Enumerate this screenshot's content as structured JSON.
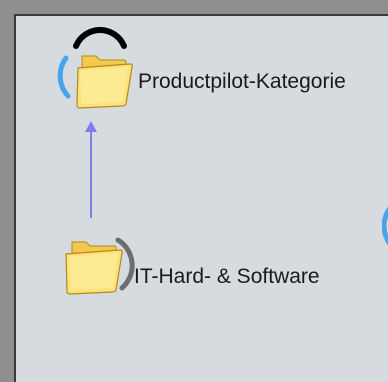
{
  "graph": {
    "nodes": [
      {
        "label": "Productpilot-Kategorie",
        "icon": "folder-icon",
        "expander": "expand-ring"
      },
      {
        "label": "IT-Hard- & Software",
        "icon": "folder-icon",
        "expander": "expand-ring"
      }
    ]
  },
  "colors": {
    "canvas": "#d6dbdf",
    "frame": "#8f8f8f",
    "edge": "#7f7fe6",
    "ring_blue": "#4aa3e8",
    "ring_black": "#000000",
    "ring_gray": "#6e6e6e",
    "folder": "#f7dc5c"
  }
}
